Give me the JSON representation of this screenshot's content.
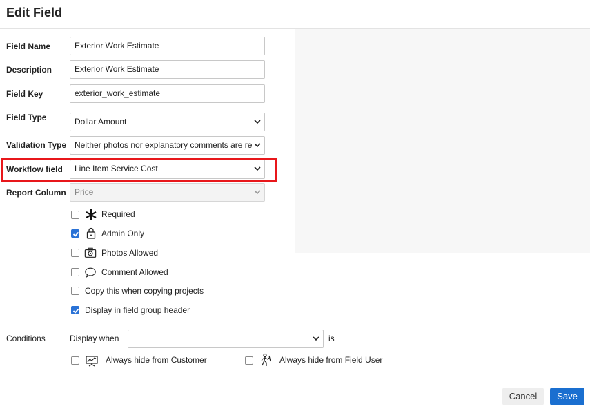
{
  "dialog": {
    "title": "Edit Field"
  },
  "form": {
    "field_name": {
      "label": "Field Name",
      "value": "Exterior Work Estimate"
    },
    "description": {
      "label": "Description",
      "value": "Exterior Work Estimate"
    },
    "field_key": {
      "label": "Field Key",
      "value": "exterior_work_estimate"
    },
    "field_type": {
      "label": "Field Type",
      "selected": "Dollar Amount"
    },
    "validation_type": {
      "label": "Validation Type",
      "selected": "Neither photos nor explanatory comments are re"
    },
    "workflow_field": {
      "label": "Workflow field",
      "selected": "Line Item Service Cost"
    },
    "report_column": {
      "label": "Report Column",
      "selected": "Price",
      "disabled": true
    }
  },
  "options": [
    {
      "label": "Required",
      "checked": false,
      "icon": "asterisk-icon"
    },
    {
      "label": "Admin Only",
      "checked": true,
      "icon": "lock-icon"
    },
    {
      "label": "Photos Allowed",
      "checked": false,
      "icon": "camera-icon"
    },
    {
      "label": "Comment Allowed",
      "checked": false,
      "icon": "speech-bubble-icon"
    },
    {
      "label": "Copy this when copying projects",
      "checked": false
    },
    {
      "label": "Display in field group header",
      "checked": true
    }
  ],
  "conditions": {
    "label": "Conditions",
    "display_when": "Display when",
    "selected": "",
    "is_text": "is",
    "hide_customer": {
      "label": "Always hide from Customer",
      "checked": false,
      "icon": "presentation-icon"
    },
    "hide_field_user": {
      "label": "Always hide from Field User",
      "checked": false,
      "icon": "worker-icon"
    }
  },
  "footer": {
    "cancel": "Cancel",
    "save": "Save"
  },
  "colors": {
    "accent": "#1a6fd0",
    "highlight": "#e8171b"
  }
}
